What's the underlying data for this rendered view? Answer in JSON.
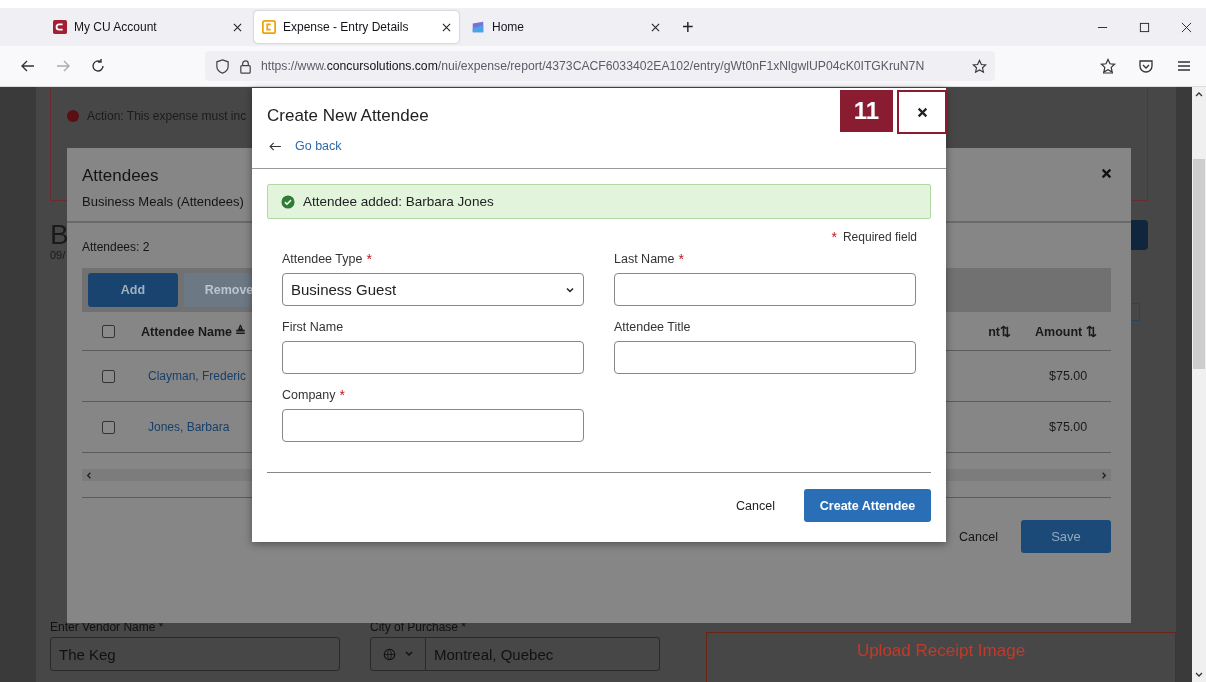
{
  "browser": {
    "tabs": [
      {
        "title": "My CU Account",
        "selected": false
      },
      {
        "title": "Expense - Entry Details",
        "selected": true
      },
      {
        "title": "Home",
        "selected": false
      }
    ],
    "new_tab": "+",
    "url": {
      "scheme": "https://www.",
      "domain": "concursolutions.com",
      "path": "/nui/expense/report/4373CACF6033402EA102/entry/gWt0nF1xNlgwlUP04cK0ITGKruN7N"
    }
  },
  "page": {
    "alert": "Action: This expense must inc",
    "heading": "B",
    "date": "09/",
    "vendor": {
      "label": "Enter Vendor Name *",
      "value": "The Keg"
    },
    "city": {
      "label": "City of Purchase *",
      "value": "Montreal, Quebec"
    },
    "upload": "Upload Receipt Image"
  },
  "attendees": {
    "title": "Attendees",
    "subtitle": "Business Meals (Attendees)",
    "count": "Attendees: 2",
    "toolbar": [
      {
        "label": "Add",
        "disabled": false
      },
      {
        "label": "Remove",
        "disabled": true
      }
    ],
    "header_checked": false,
    "columns": [
      {
        "label": "Attendee Name",
        "sort": "≜"
      },
      {
        "label": "nt",
        "sort": "⇅"
      },
      {
        "label": "Amount",
        "sort": "⇅"
      }
    ],
    "rows": [
      {
        "name": "Clayman, Frederic",
        "amount": "$75.00",
        "checked": false
      },
      {
        "name": "Jones, Barbara",
        "amount": "$75.00",
        "checked": false
      }
    ],
    "buttons": {
      "cancel": "Cancel",
      "save": "Save"
    }
  },
  "create": {
    "title": "Create New Attendee",
    "back": "Go back",
    "success": "Attendee added: Barbara Jones",
    "required_mark": "*",
    "required_note": "Required field",
    "fields": [
      {
        "label": "Attendee Type",
        "required": true,
        "kind": "select",
        "value": "Business Guest"
      },
      {
        "label": "Last Name",
        "required": true,
        "kind": "text"
      },
      {
        "label": "First Name",
        "required": false,
        "kind": "text"
      },
      {
        "label": "Attendee Title",
        "required": false,
        "kind": "text"
      },
      {
        "label": "Company",
        "required": true,
        "kind": "text"
      }
    ],
    "cancel": "Cancel",
    "submit": "Create Attendee"
  },
  "step_badge": "11"
}
